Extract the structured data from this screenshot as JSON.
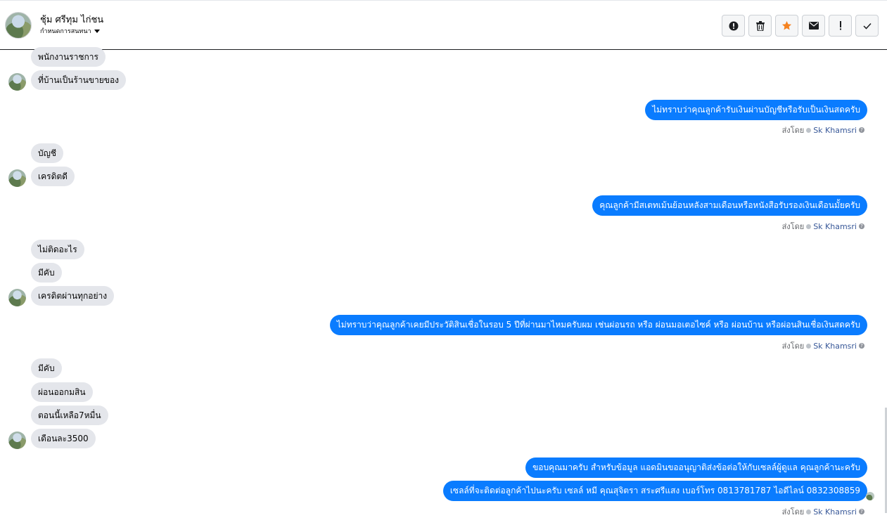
{
  "header": {
    "name": "ชุ้ม ศรีทุม ไก่ชน",
    "status": "กำหนดการสนทนา"
  },
  "actions": [
    {
      "name": "mark-spam-button",
      "icon": "alert-circle-icon"
    },
    {
      "name": "delete-button",
      "icon": "trash-icon"
    },
    {
      "name": "star-button",
      "icon": "star-icon"
    },
    {
      "name": "mark-unread-button",
      "icon": "envelope-icon"
    },
    {
      "name": "follow-up-button",
      "icon": "exclamation-icon"
    },
    {
      "name": "mark-done-button",
      "icon": "check-icon"
    }
  ],
  "colors": {
    "outgoing": "#0a7cff",
    "incoming": "#e4e6eb",
    "star": "#f5821f"
  },
  "sent_label": "ส่งโดย",
  "sender": "Sk Khamsri",
  "messages": {
    "m1": "พนักงานราชการ",
    "m2": "ที่บ้านเป็นร้านขายของ",
    "m3": "ไม่ทราบว่าคุณลูกค้ารับเงินผ่านบัญชีหรือรับเป็นเงินสดครับ",
    "m4": "บัญชี",
    "m5": "เครดิตดี",
    "m6": "คุณลูกค้ามีสเตทเม้นย้อนหลังสามเดือนหรือหนังสือรับรองเงินเดือนมั้ยครับ",
    "m7": "ไม่ติดอะไร",
    "m8": "มีคับ",
    "m9": "เครดิตผ่านทุกอย่าง",
    "m10": "ไม่ทราบว่าคุณลูกค้าเคยมีประวัติสินเชื่อในรอบ 5 ปีที่ผ่านมาไหมครับผม เช่นผ่อนรถ หรือ ผ่อนมอเตอไซค์ หรือ ผ่อนบ้าน หรือผ่อนสินเชื่อเงินสดครับ",
    "m11": "มีคับ",
    "m12": "ผ่อนออกมสิน",
    "m13": "ตอนนี้เหลือ7หมื่น",
    "m14": "เดือนละ3500",
    "m15": "ขอบคุณมาครับ สำหรับข้อมูล แอดมินขออนุญาติส่งข้อต่อให้กับเซลล์ผู้ดูแล คุณลูกค้านะครับ",
    "m16": "เซลล์ที่จะติดต่อลูกค้าไปนะครับ เซลล์ หมี คุณสุจิตรา สระศรีแสง เบอร์โทร 0813781787 ไอดีไลน์ 0832308859"
  }
}
